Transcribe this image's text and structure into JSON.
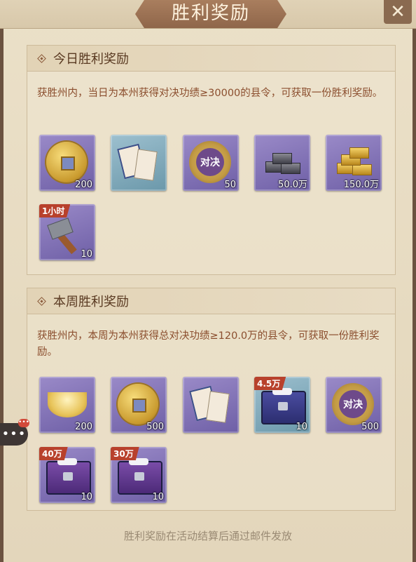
{
  "window": {
    "title": "胜利奖励",
    "close_label": "✕"
  },
  "daily": {
    "title": "今日胜利奖励",
    "description": "获胜州内，当日为本州获得对决功绩≥30000的县令，可获取一份胜利奖励。",
    "items": [
      {
        "icon": "copper-coin-icon",
        "quantity": "200",
        "rarity": "purple"
      },
      {
        "icon": "card-set-icon",
        "quantity": "",
        "rarity": "blue"
      },
      {
        "icon": "duel-token-icon",
        "quantity": "50",
        "rarity": "purple"
      },
      {
        "icon": "silver-bars-icon",
        "quantity": "50.0万",
        "rarity": "purple"
      },
      {
        "icon": "gold-bars-icon",
        "quantity": "150.0万",
        "rarity": "purple"
      },
      {
        "icon": "hammer-icon",
        "quantity": "10",
        "rarity": "purple",
        "tag": "1小时"
      }
    ]
  },
  "weekly": {
    "title": "本周胜利奖励",
    "description": "获胜州内，本周为本州获得总对决功绩≥120.0万的县令，可获取一份胜利奖励。",
    "items": [
      {
        "icon": "gold-ingot-icon",
        "quantity": "200",
        "rarity": "purple"
      },
      {
        "icon": "copper-coin-icon",
        "quantity": "500",
        "rarity": "purple"
      },
      {
        "icon": "card-set-icon",
        "quantity": "",
        "rarity": "purple"
      },
      {
        "icon": "treasure-chest-icon",
        "quantity": "10",
        "rarity": "blue",
        "tag": "4.5万"
      },
      {
        "icon": "duel-token-icon",
        "quantity": "500",
        "rarity": "purple"
      },
      {
        "icon": "treasure-chest-icon",
        "quantity": "10",
        "rarity": "purple",
        "tag": "40万"
      },
      {
        "icon": "treasure-chest-icon",
        "quantity": "10",
        "rarity": "purple",
        "tag": "30万"
      }
    ]
  },
  "footer": "胜利奖励在活动结算后通过邮件发放",
  "chat": {
    "icon": "chat-bubble-icon",
    "dots": "•••"
  },
  "colors": {
    "accent": "#8b4e2e",
    "banner": "#9a7052",
    "tag": "#b8412c"
  }
}
